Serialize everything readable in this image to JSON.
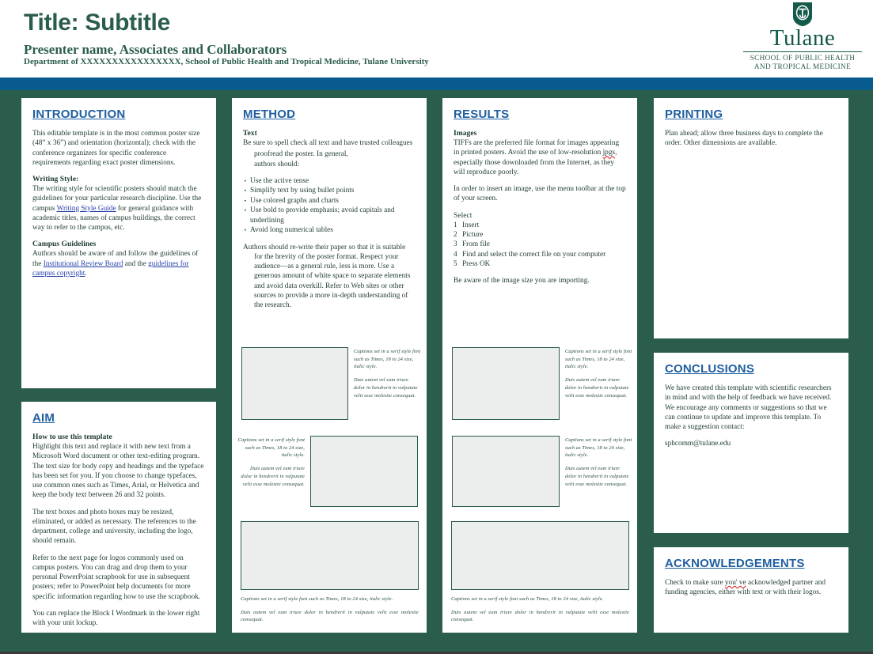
{
  "header": {
    "title": "Title: Subtitle",
    "presenter": "Presenter name, Associates and Collaborators",
    "affiliation": "Department of XXXXXXXXXXXXXXXX,  School of Public Health and Tropical Medicine, Tulane University"
  },
  "logo": {
    "wordmark": "Tulane",
    "subline_1": "SCHOOL OF PUBLIC HEALTH",
    "subline_2": "AND TROPICAL MEDICINE",
    "shield_letter": "T"
  },
  "colors": {
    "green": "#2b5d4c",
    "blue_bar": "#075b8e",
    "heading_blue": "#1f5fa0",
    "link_blue": "#2640a8",
    "placeholder_gray": "#eceded",
    "spellcheck_red": "#d81212"
  },
  "introduction": {
    "heading": "INTRODUCTION",
    "p1": "This editable template is in the most common poster size (48” x 36”) and orientation (horizontal); check with the conference organizers for specific conference requirements regarding exact poster dimensions.",
    "writing_style_head": "Writing Style:",
    "writing_style_a": "The writing style for scientific posters should match the guidelines for your particular research discipline. Use the campus ",
    "writing_style_link": "Writing Style Guide",
    "writing_style_b": " for general guidance with academic titles, names of campus buildings, the correct way to refer to the campus, etc.",
    "campus_guidelines_head": "Campus Guidelines",
    "campus_a": "Authors should be aware of and follow the guidelines of the ",
    "campus_link_1": "Institutional Review Board",
    "campus_b": " and the ",
    "campus_link_2": "guidelines for campus copyright",
    "campus_c": "."
  },
  "aim": {
    "heading": "AIM",
    "sub_head": "How to use this template",
    "p1": "Highlight this text and replace it with new text from a Microsoft Word document or other text-editing program. The text size for body copy and headings and the typeface has been set for you. If you choose to change typefaces, use common ones such as Times, Arial, or Helvetica and keep the body text between 26 and 32 points.",
    "p2": "The text boxes and photo boxes may be resized, eliminated, or added as necessary. The references to the department, college and university, including the logo, should remain.",
    "p3": "Refer to the next page for logos commonly used on campus posters.  You can drag and drop them to your personal PowerPoint scrapbook for use in subsequent posters; refer to PowerPoint help documents for more specific information regarding how to use the scrapbook.",
    "p4": "You can replace the Block I Wordmark in the lower right with your unit lockup."
  },
  "method": {
    "heading": "METHOD",
    "text_head": "Text",
    "p1": "Be sure to spell check all text and have trusted colleagues",
    "p1_indent_a": "proofread the poster. In general,",
    "p1_indent_b": "authors should:",
    "bullets": [
      "Use the active tense",
      "Simplify text by using bullet points",
      "Use colored graphs and charts",
      "Use bold to provide emphasis; avoid capitals and underlining",
      "Avoid long numerical tables"
    ],
    "p2_first": "Authors should re-write their paper so that it is suitable",
    "p2_rest": "for the brevity of the poster format. Respect your audience—as a general rule, less is more. Use a generous amount of white space to separate elements and avoid data overkill. Refer to Web sites or other sources to provide a more in-depth understanding of the research."
  },
  "results": {
    "heading": "RESULTS",
    "images_head": "Images",
    "p1_a": "TIFFs are the preferred file format for images appearing in printed posters. Avoid the use of low-resolution ",
    "p1_misspelled": "jpgs",
    "p1_b": ", especially those downloaded from the Internet, as they will reproduce poorly.",
    "p2": "In order to insert an image, use the menu toolbar at the top of your screen.",
    "select_head": "Select",
    "steps": [
      {
        "n": "1",
        "text": "Insert"
      },
      {
        "n": "2",
        "text": "Picture"
      },
      {
        "n": "3",
        "text": "From file"
      },
      {
        "n": "4",
        "text": "Find and select the correct file on your computer"
      },
      {
        "n": "5",
        "text": "Press OK"
      }
    ],
    "p3": "Be aware of the image size you are importing."
  },
  "printing": {
    "heading": "PRINTING",
    "p1": "Plan ahead; allow three business days to complete the order. Other dimensions are available."
  },
  "conclusions": {
    "heading": "CONCLUSIONS",
    "p1": "We have created this template with scientific researchers in mind and with the help of feedback we have received. We encourage any comments or suggestions so that we can continue to update and improve this template. To make a suggestion contact:",
    "email": "sphcomm@tulane.edu"
  },
  "acknowledgements": {
    "heading": "ACKNOWLEDGEMENTS",
    "p1_a": "Check to make sure ",
    "p1_misspelled": "you' ve",
    "p1_b": " acknowledged partner and funding agencies, either with text or with their logos."
  },
  "captions": {
    "line_1": "Captions  set in a serif style font such as Times,  18 to 24 size,  italic style.",
    "line_2": "Duis  autem  vel  eum  iriure  dolor  in  hendrerit   in  vulputate   velit  esse  molestie   consequat.",
    "wide_line_1": "Captions  set in a serif  style font such  as Times,  18 to 24 size,  italic style.",
    "wide_line_2": "Duis  autem  vel  eum  iriure  dolor  in  hendrerit   in  vulputate  velit  esse  molestie  consequat."
  }
}
